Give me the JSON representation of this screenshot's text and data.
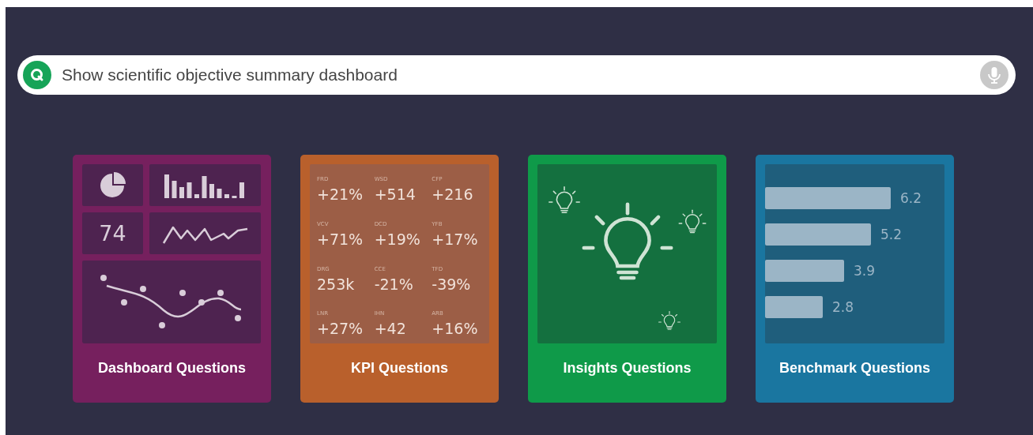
{
  "search": {
    "value": "Show scientific objective summary dashboard"
  },
  "cards": [
    {
      "kind": "dashboard",
      "title": "Dashboard Questions",
      "number": "74"
    },
    {
      "kind": "kpi",
      "title": "KPI Questions",
      "kpis": [
        {
          "label": "FRD",
          "value": "+21%"
        },
        {
          "label": "WSD",
          "value": "+514"
        },
        {
          "label": "CFP",
          "value": "+216"
        },
        {
          "label": "VCV",
          "value": "+71%"
        },
        {
          "label": "DCD",
          "value": "+19%"
        },
        {
          "label": "YFB",
          "value": "+17%"
        },
        {
          "label": "DRG",
          "value": "253k"
        },
        {
          "label": "CCE",
          "value": "-21%"
        },
        {
          "label": "TFD",
          "value": "-39%"
        },
        {
          "label": "LNR",
          "value": "+27%"
        },
        {
          "label": "IHN",
          "value": "+42"
        },
        {
          "label": "ARB",
          "value": "+16%"
        }
      ]
    },
    {
      "kind": "insights",
      "title": "Insights Questions"
    },
    {
      "kind": "benchmark",
      "title": "Benchmark Questions",
      "bars": [
        {
          "label": "6.2"
        },
        {
          "label": "5.2"
        },
        {
          "label": "3.9"
        },
        {
          "label": "2.8"
        }
      ]
    }
  ]
}
